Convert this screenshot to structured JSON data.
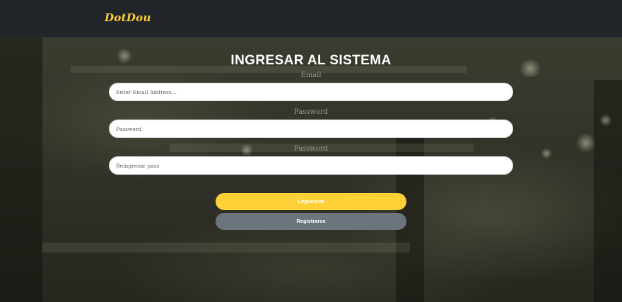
{
  "navbar": {
    "brand": "DotDou"
  },
  "form": {
    "title": "INGRESAR AL SISTEMA",
    "email": {
      "label": "Email",
      "placeholder": "Enter Email Address..."
    },
    "password": {
      "label": "Password",
      "placeholder": "Password"
    },
    "password_confirm": {
      "label": "Password",
      "placeholder": "Reingresar pass"
    },
    "login_button": "Loguearse",
    "register_button": "Registrarse"
  },
  "colors": {
    "navbar_bg": "#212529",
    "brand": "#fed136",
    "primary_button": "#fed136",
    "secondary_button": "#6c757d"
  }
}
